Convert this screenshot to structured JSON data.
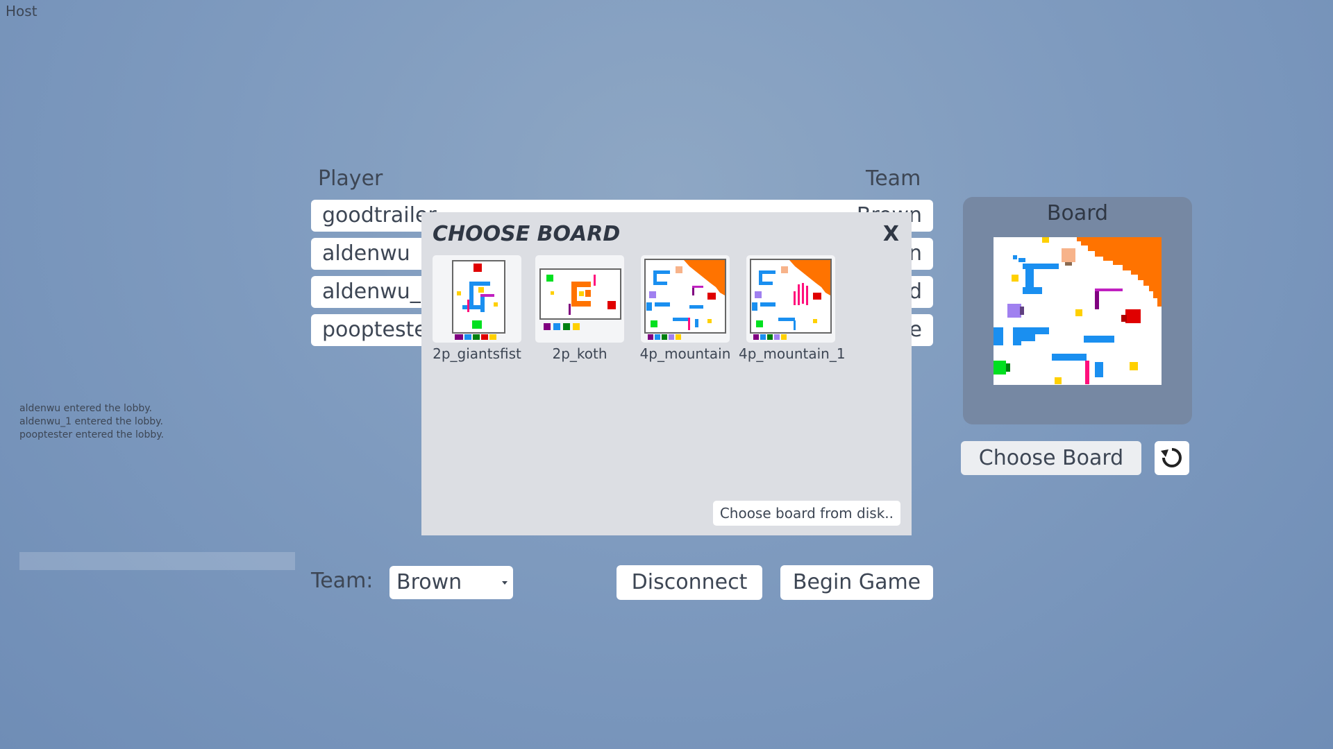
{
  "host_label": "Host",
  "players_table": {
    "header_player": "Player",
    "header_team": "Team",
    "rows": [
      {
        "name": "goodtrailer",
        "team": "Brown"
      },
      {
        "name": "aldenwu",
        "team": "n"
      },
      {
        "name": "aldenwu_1",
        "team": "d"
      },
      {
        "name": "poopteste",
        "team": "e"
      }
    ]
  },
  "log": [
    "aldenwu entered the lobby.",
    "aldenwu_1 entered the lobby.",
    "pooptester entered the lobby."
  ],
  "team_selector": {
    "label": "Team:",
    "value": "Brown"
  },
  "buttons": {
    "disconnect": "Disconnect",
    "begin_game": "Begin Game",
    "choose_board": "Choose Board"
  },
  "board_panel": {
    "title": "Board",
    "refresh_icon": "refresh-icon"
  },
  "modal": {
    "title": "CHOOSE BOARD",
    "close": "X",
    "boards": [
      "2p_giantsfist",
      "2p_koth",
      "4p_mountain",
      "4p_mountain_1"
    ],
    "disk_button": "Choose board from disk.."
  },
  "colors": {
    "background": "#7f9bbf",
    "panel": "#7688a3",
    "modal": "#dcdee3",
    "text": "#3d4654"
  }
}
